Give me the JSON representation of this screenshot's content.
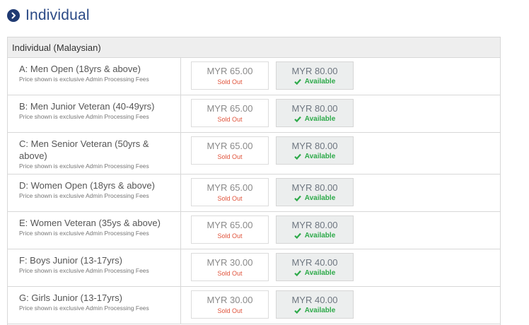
{
  "section": {
    "title": "Individual"
  },
  "panel": {
    "title": "Individual (Malaysian)"
  },
  "note": "Price shown is exclusive Admin Processing Fees",
  "rows": [
    {
      "name": "A: Men Open (18yrs & above)",
      "price1": "MYR 65.00",
      "status1": "Sold Out",
      "price2": "MYR 80.00",
      "status2": "Available"
    },
    {
      "name": "B: Men Junior Veteran (40-49yrs)",
      "price1": "MYR 65.00",
      "status1": "Sold Out",
      "price2": "MYR 80.00",
      "status2": "Available"
    },
    {
      "name": "C: Men Senior Veteran (50yrs & above)",
      "price1": "MYR 65.00",
      "status1": "Sold Out",
      "price2": "MYR 80.00",
      "status2": "Available"
    },
    {
      "name": "D: Women Open (18yrs & above)",
      "price1": "MYR 65.00",
      "status1": "Sold Out",
      "price2": "MYR 80.00",
      "status2": "Available"
    },
    {
      "name": "E: Women Veteran (35ys & above)",
      "price1": "MYR 65.00",
      "status1": "Sold Out",
      "price2": "MYR 80.00",
      "status2": "Available"
    },
    {
      "name": "F: Boys Junior (13-17yrs)",
      "price1": "MYR 30.00",
      "status1": "Sold Out",
      "price2": "MYR 40.00",
      "status2": "Available"
    },
    {
      "name": "G: Girls Junior (13-17yrs)",
      "price1": "MYR 30.00",
      "status1": "Sold Out",
      "price2": "MYR 40.00",
      "status2": "Available"
    }
  ],
  "colors": {
    "accent": "#1f3a72",
    "sold_out": "#e0533b",
    "available": "#2eaa4a"
  },
  "icons": {
    "section": "chevron-right-circle-icon",
    "available": "check-icon"
  }
}
